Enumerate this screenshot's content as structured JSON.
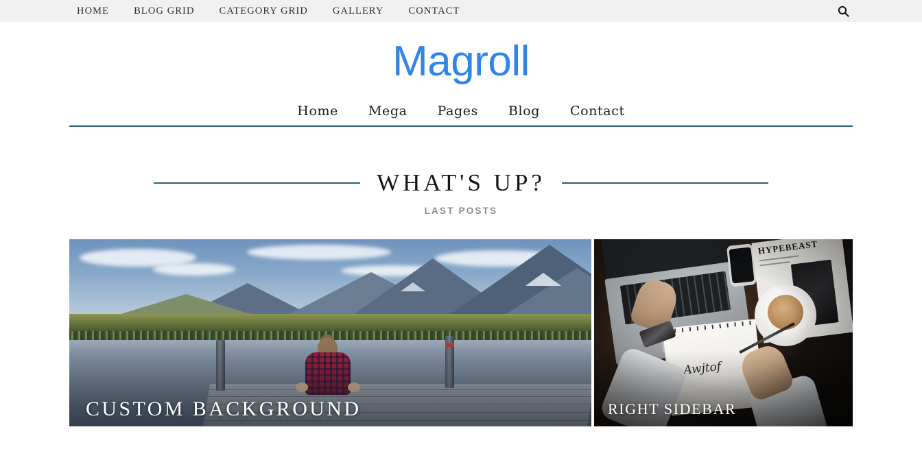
{
  "topbar": {
    "items": [
      {
        "label": "HOME"
      },
      {
        "label": "BLOG GRID"
      },
      {
        "label": "CATEGORY GRID"
      },
      {
        "label": "GALLERY"
      },
      {
        "label": "CONTACT"
      }
    ],
    "search_icon": "search-icon",
    "background_color": "#f1f1f1"
  },
  "brand": {
    "title": "Magroll",
    "color": "#2f86e8"
  },
  "mainnav": {
    "items": [
      {
        "label": "Home"
      },
      {
        "label": "Mega"
      },
      {
        "label": "Pages"
      },
      {
        "label": "Blog"
      },
      {
        "label": "Contact"
      }
    ],
    "underline_color": "#2c5f77"
  },
  "section": {
    "title": "WHAT'S UP?",
    "subtitle": "LAST POSTS",
    "rule_color": "#2c5f77",
    "subtitle_color": "#8c8c8c"
  },
  "posts": [
    {
      "title": "CUSTOM BACKGROUND",
      "image_alt": "Person in red plaid shirt sitting on a wooden dock facing a mountain lake at dusk"
    },
    {
      "title": "RIGHT SIDEBAR",
      "image_alt": "Overhead view of a dark wooden desk with a laptop, smartphone, coffee cup, magazine and a sketchbook with hand lettering",
      "magazine_text": "HYPEBEAST",
      "sketch_text": "Awjtof"
    }
  ]
}
